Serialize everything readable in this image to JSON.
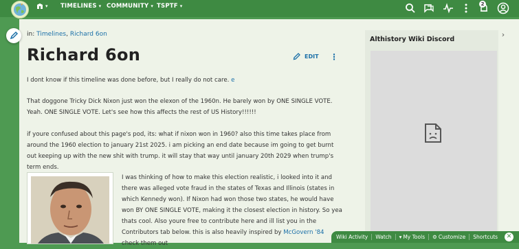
{
  "nav": {
    "timelines": "TIMELINES",
    "community": "COMMUNITY",
    "tsptf": "TSPTF",
    "notification_count": "2"
  },
  "breadcrumb": {
    "prefix": "in:",
    "link1": "Timelines",
    "separator": ",",
    "link2": "Richard 6on"
  },
  "page": {
    "title": "Richard 6on",
    "edit_label": "EDIT"
  },
  "content": {
    "p1_text": "I dont know if this timeline was done before, but I really do not care. ",
    "p1_link": "e",
    "p2": "That doggone Tricky Dick Nixon just won the elexon of the 1960n. He barely won by ONE SINGLE VOTE. Yeah. ONE SINGLE VOTE. Let's see how this affects the rest of US History!!!!!!",
    "p3": "if youre confused about this page's pod, its: what if nixon won in 1960? also this time takes place from around the 1960 election to january 21st 2025. i am picking an end date because im going to get burnt out keeping up with the new shit with trump. it will stay that way until january 20th 2029 when trump's term ends.",
    "p4_text": "I was thinking of how to make this election realistic, i looked into it and there was alleged vote fraud in the states of Texas and Illinois (states in which Kennedy won). If Nixon had won those two states, he would have won BY ONE SINGLE VOTE, making it the closest election in history. So yea thats cool. Also youre free to contribute here and ill list you in the Contributors tab below. this is also heavily inspired by ",
    "p4_link": "McGovern '84",
    "p4_tail": " check them out"
  },
  "sidebar": {
    "title": "Althistory Wiki Discord"
  },
  "toolbar": {
    "wiki_activity": "Wiki Activity",
    "watch": "Watch",
    "my_tools": "My Tools",
    "customize": "Customize",
    "shortcuts": "Shortcuts"
  },
  "colors": {
    "brand_green": "#4e9a52",
    "link_blue": "#1a6fa8"
  }
}
